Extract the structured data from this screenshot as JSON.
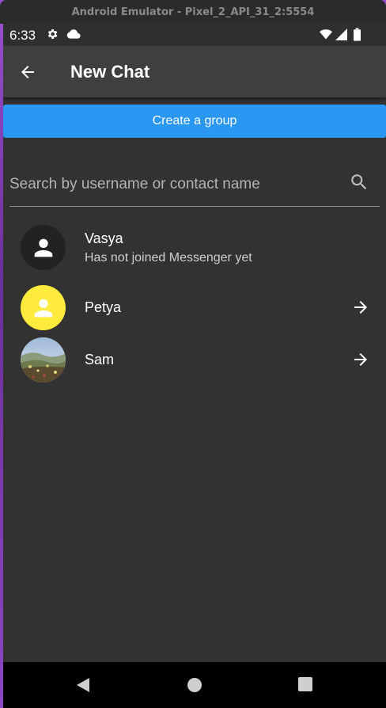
{
  "window": {
    "title": "Android Emulator - Pixel_2_API_31_2:5554"
  },
  "status_bar": {
    "time": "6:33"
  },
  "app_bar": {
    "title": "New Chat"
  },
  "create_group": {
    "label": "Create a group",
    "color": "#2a97f2"
  },
  "search": {
    "placeholder": "Search by username or contact name",
    "value": ""
  },
  "contacts": [
    {
      "name": "Vasya",
      "subtitle": "Has not joined Messenger yet",
      "avatar": "person-icon",
      "avatar_bg": "#222222",
      "action": null
    },
    {
      "name": "Petya",
      "subtitle": "",
      "avatar": "person-icon",
      "avatar_bg": "#ffeb3b",
      "action": "arrow-right-icon"
    },
    {
      "name": "Sam",
      "subtitle": "",
      "avatar": "photo-avatar",
      "avatar_bg": null,
      "action": "arrow-right-icon"
    }
  ],
  "colors": {
    "background": "#323232",
    "app_bar": "#3f3f3f",
    "accent": "#2a97f2"
  }
}
